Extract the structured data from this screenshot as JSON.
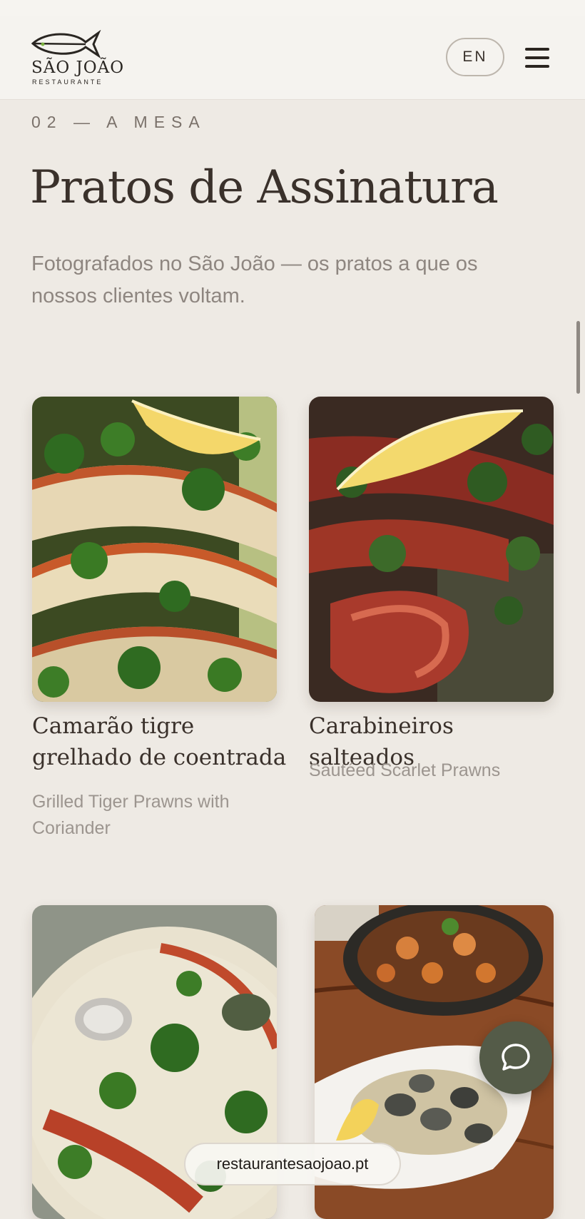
{
  "header": {
    "logo_name": "SÃO JOÃO",
    "logo_sub": "RESTAURANTE",
    "lang_label": "EN",
    "menu_icon": "hamburger-icon"
  },
  "section": {
    "eyebrow": "02 — A MESA",
    "title": "Pratos de Assinatura",
    "subtitle": "Fotografados no São João — os pratos a que os nossos clientes voltam."
  },
  "dishes": [
    {
      "name": "Camarão tigre grelhado de coentrada",
      "name_en": "Grilled Tiger Prawns with Coriander"
    },
    {
      "name": "Carabineiros salteados",
      "name_en": "Sautéed Scarlet Prawns"
    },
    {
      "name": "",
      "name_en": ""
    },
    {
      "name": "",
      "name_en": ""
    }
  ],
  "chat": {
    "icon": "chat-bubble-icon"
  },
  "browser": {
    "url": "restaurantesaojoao.pt"
  }
}
